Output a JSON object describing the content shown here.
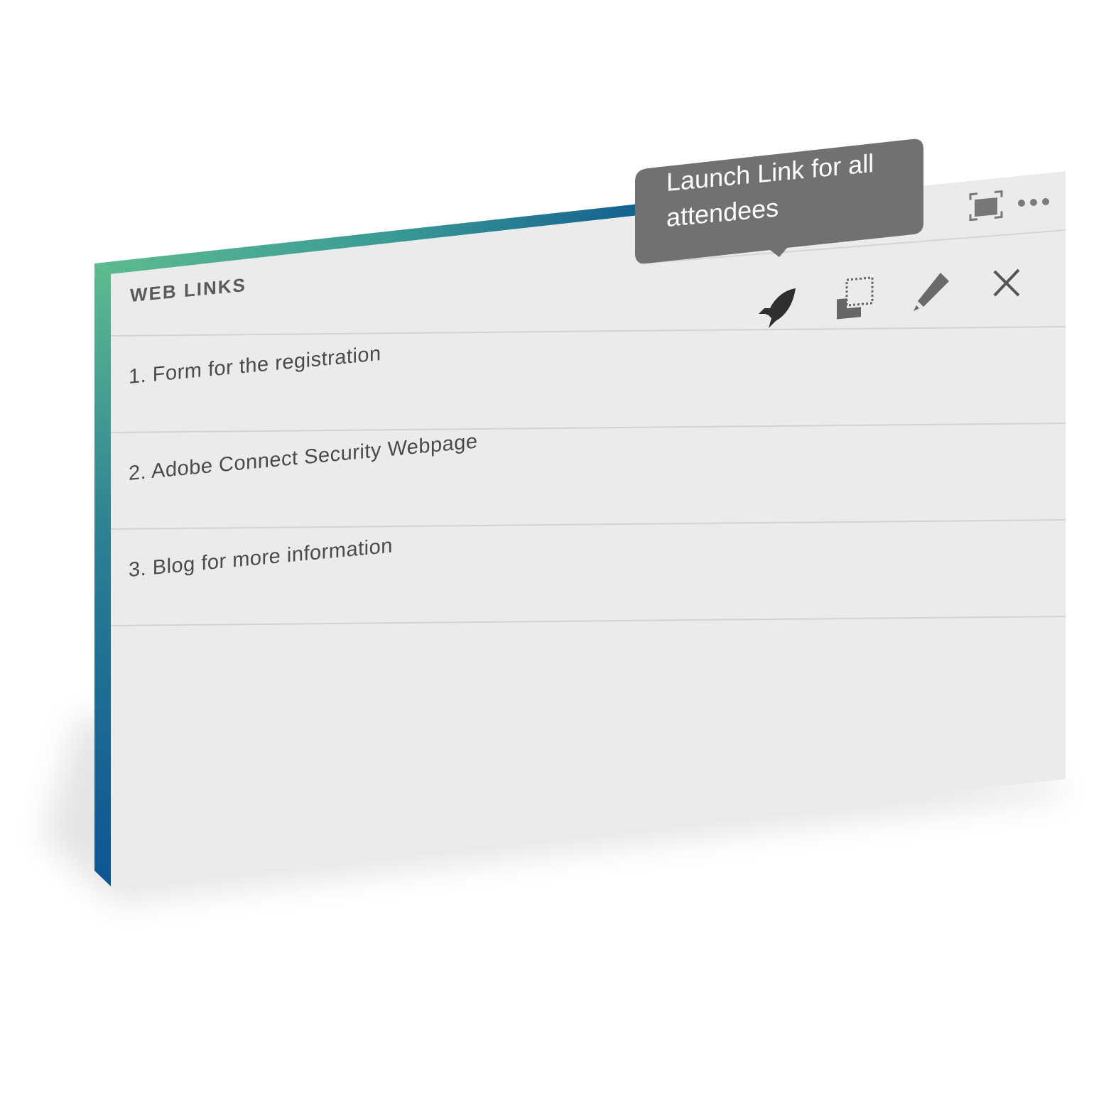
{
  "panel": {
    "title": "WEB LINKS",
    "links": [
      "1. Form for the registration",
      "2. Adobe Connect Security Webpage",
      "3. Blog for more information"
    ]
  },
  "toolbar": {
    "icons": [
      "rocket-icon",
      "copy-icon",
      "pencil-icon",
      "close-icon"
    ]
  },
  "header_icons": [
    "fullscreen-icon",
    "more-icon"
  ],
  "tooltip": {
    "text": "Launch Link for all attendees"
  },
  "colors": {
    "panel_bg": "#ebebeb",
    "tooltip_bg": "#717171",
    "accent_top": "#5dbb8f",
    "accent_bottom": "#0c5593",
    "text": "#4a4a4a",
    "icon": "#555555"
  }
}
